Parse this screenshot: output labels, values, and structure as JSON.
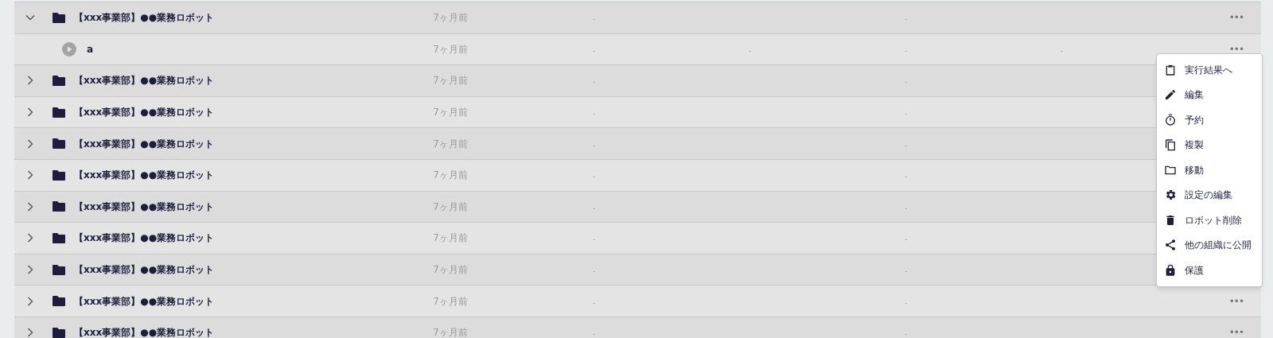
{
  "rows": [
    {
      "kind": "folder",
      "expanded": true,
      "name": "【xxx事業部】●●業務ロボット",
      "time": "7ヶ月前",
      "column_3": "-",
      "column_5": "-",
      "more": "•••",
      "children": [
        {
          "kind": "robot",
          "name": "a",
          "time": "7ヶ月前",
          "column_3": "-",
          "column_4": "-",
          "column_5": "-",
          "column_6": "-",
          "more": "•••"
        }
      ]
    },
    {
      "kind": "folder",
      "expanded": false,
      "name": "【xxx事業部】●●業務ロボット",
      "time": "7ヶ月前",
      "column_3": "-",
      "column_5": "-"
    },
    {
      "kind": "folder",
      "expanded": false,
      "name": "【xxx事業部】●●業務ロボット",
      "time": "7ヶ月前",
      "column_3": "-",
      "column_5": "-"
    },
    {
      "kind": "folder",
      "expanded": false,
      "name": "【xxx事業部】●●業務ロボット",
      "time": "7ヶ月前",
      "column_3": "-",
      "column_5": "-"
    },
    {
      "kind": "folder",
      "expanded": false,
      "name": "【xxx事業部】●●業務ロボット",
      "time": "7ヶ月前",
      "column_3": "-",
      "column_5": "-"
    },
    {
      "kind": "folder",
      "expanded": false,
      "name": "【xxx事業部】●●業務ロボット",
      "time": "7ヶ月前",
      "column_3": "-",
      "column_5": "-"
    },
    {
      "kind": "folder",
      "expanded": false,
      "name": "【xxx事業部】●●業務ロボット",
      "time": "7ヶ月前",
      "column_3": "-",
      "column_5": "-"
    },
    {
      "kind": "folder",
      "expanded": false,
      "name": "【xxx事業部】●●業務ロボット",
      "time": "7ヶ月前",
      "column_3": "-",
      "column_5": "-"
    },
    {
      "kind": "folder",
      "expanded": false,
      "name": "【xxx事業部】●●業務ロボット",
      "time": "7ヶ月前",
      "column_3": "-",
      "column_5": "-",
      "more": "•••"
    },
    {
      "kind": "folder",
      "expanded": false,
      "name": "【xxx事業部】●●業務ロボット",
      "time": "7ヶ月前",
      "column_3": "-",
      "column_5": "-",
      "more": "•••"
    }
  ],
  "context_menu": {
    "items": [
      {
        "kind": "clipboard",
        "label": "実行結果へ"
      },
      {
        "kind": "pencil",
        "label": "編集"
      },
      {
        "kind": "timer",
        "label": "予約"
      },
      {
        "kind": "copy",
        "label": "複製"
      },
      {
        "kind": "folder",
        "label": "移動"
      },
      {
        "kind": "gear",
        "label": "設定の編集"
      },
      {
        "kind": "trash",
        "label": "ロボット削除"
      },
      {
        "kind": "share",
        "label": "他の組織に公開"
      },
      {
        "kind": "lock",
        "label": "保護"
      }
    ]
  }
}
